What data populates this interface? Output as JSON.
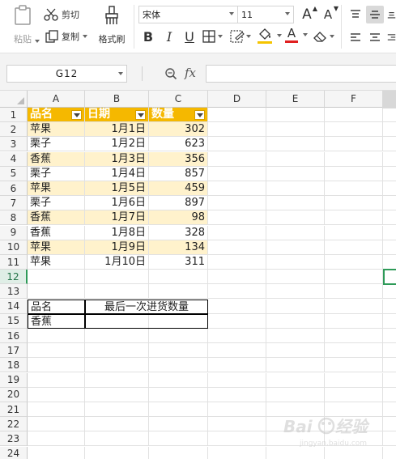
{
  "ribbon": {
    "paste_label": "粘贴",
    "cut_label": "剪切",
    "copy_label": "复制",
    "format_painter_label": "格式刷",
    "font_name": "宋体",
    "font_size": "11",
    "bold": "B",
    "italic": "I",
    "underline": "U",
    "grow_font": "A",
    "shrink_font": "A",
    "font_color_letter": "A",
    "accent_red": "#e02020",
    "accent_yellow": "#f5c400"
  },
  "formula_bar": {
    "name_box": "G12",
    "fx_label": "fx",
    "formula": ""
  },
  "sheet": {
    "columns": [
      "A",
      "B",
      "C",
      "D",
      "E",
      "F"
    ],
    "selected_column": "G",
    "selected_row": "12",
    "row_numbers": [
      "1",
      "2",
      "3",
      "4",
      "5",
      "6",
      "7",
      "8",
      "9",
      "10",
      "11",
      "12",
      "13",
      "14",
      "15",
      "16",
      "17",
      "18",
      "19",
      "20",
      "21",
      "22",
      "23",
      "24"
    ],
    "table_headers": [
      "品名",
      "日期",
      "数量"
    ],
    "table_rows": [
      [
        "苹果",
        "1月1日",
        "302"
      ],
      [
        "栗子",
        "1月2日",
        "623"
      ],
      [
        "香蕉",
        "1月3日",
        "356"
      ],
      [
        "栗子",
        "1月4日",
        "857"
      ],
      [
        "苹果",
        "1月5日",
        "459"
      ],
      [
        "栗子",
        "1月6日",
        "897"
      ],
      [
        "香蕉",
        "1月7日",
        "98"
      ],
      [
        "香蕉",
        "1月8日",
        "328"
      ],
      [
        "苹果",
        "1月9日",
        "134"
      ],
      [
        "苹果",
        "1月10日",
        "311"
      ]
    ],
    "lookup_header_name": "品名",
    "lookup_header_value": "最后一次进货数量",
    "lookup_name": "香蕉",
    "lookup_value": ""
  },
  "watermark": {
    "brand": "Baidu",
    "sub": "jingyan.baidu.com"
  }
}
